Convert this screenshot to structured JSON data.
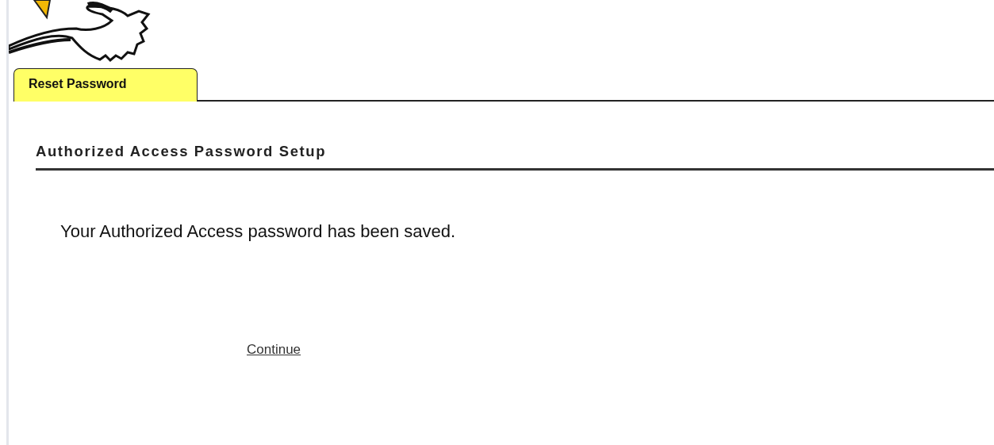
{
  "tabs": [
    {
      "label": "Reset Password",
      "selected": true
    }
  ],
  "section": {
    "title": "Authorized Access Password Setup"
  },
  "message": "Your Authorized Access password has been saved.",
  "continue_link": "Continue"
}
